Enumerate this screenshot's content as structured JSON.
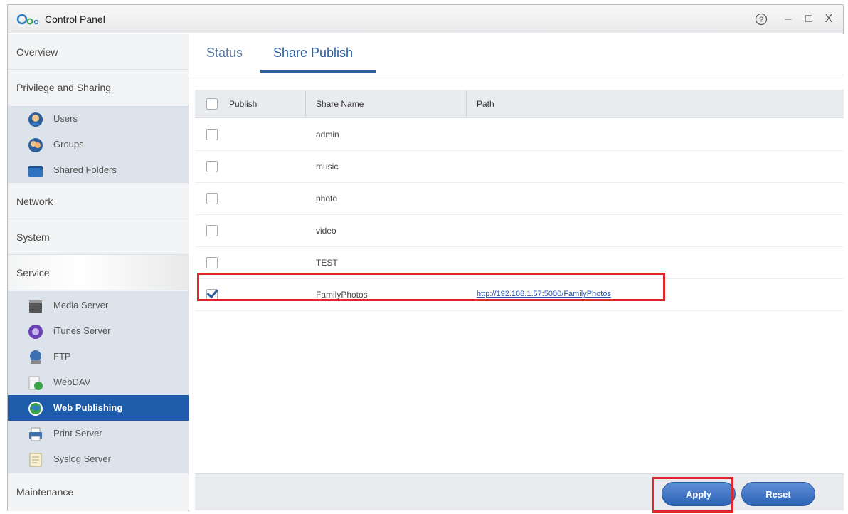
{
  "window": {
    "title": "Control Panel"
  },
  "titlebar_buttons": {
    "help": "?",
    "minimize": "–",
    "maximize": "□",
    "close": "X"
  },
  "sidebar": {
    "categories": {
      "overview": "Overview",
      "privilege": "Privilege and Sharing",
      "network": "Network",
      "system": "System",
      "service": "Service",
      "maintenance": "Maintenance"
    },
    "privilege_items": [
      {
        "label": "Users",
        "icon": "user-icon"
      },
      {
        "label": "Groups",
        "icon": "groups-icon"
      },
      {
        "label": "Shared Folders",
        "icon": "folder-icon"
      }
    ],
    "service_items": [
      {
        "label": "Media Server",
        "icon": "media-server-icon"
      },
      {
        "label": "iTunes Server",
        "icon": "itunes-icon"
      },
      {
        "label": "FTP",
        "icon": "ftp-icon"
      },
      {
        "label": "WebDAV",
        "icon": "webdav-icon"
      },
      {
        "label": "Web Publishing",
        "icon": "globe-icon",
        "active": true
      },
      {
        "label": "Print Server",
        "icon": "printer-icon"
      },
      {
        "label": "Syslog Server",
        "icon": "syslog-icon"
      }
    ]
  },
  "tabs": {
    "status": "Status",
    "share_publish": "Share Publish",
    "active": "share_publish"
  },
  "table": {
    "headers": {
      "publish": "Publish",
      "share_name": "Share Name",
      "path": "Path"
    },
    "rows": [
      {
        "name": "admin",
        "checked": false,
        "path": ""
      },
      {
        "name": "music",
        "checked": false,
        "path": ""
      },
      {
        "name": "photo",
        "checked": false,
        "path": ""
      },
      {
        "name": "video",
        "checked": false,
        "path": ""
      },
      {
        "name": "TEST",
        "checked": false,
        "path": ""
      },
      {
        "name": "FamilyPhotos",
        "checked": true,
        "path": "http://192.168.1.57:5000/FamilyPhotos"
      }
    ]
  },
  "buttons": {
    "apply": "Apply",
    "reset": "Reset"
  },
  "colors": {
    "accent": "#2b5f9e",
    "active_item": "#1e5ba8",
    "highlight": "#e0262b"
  }
}
